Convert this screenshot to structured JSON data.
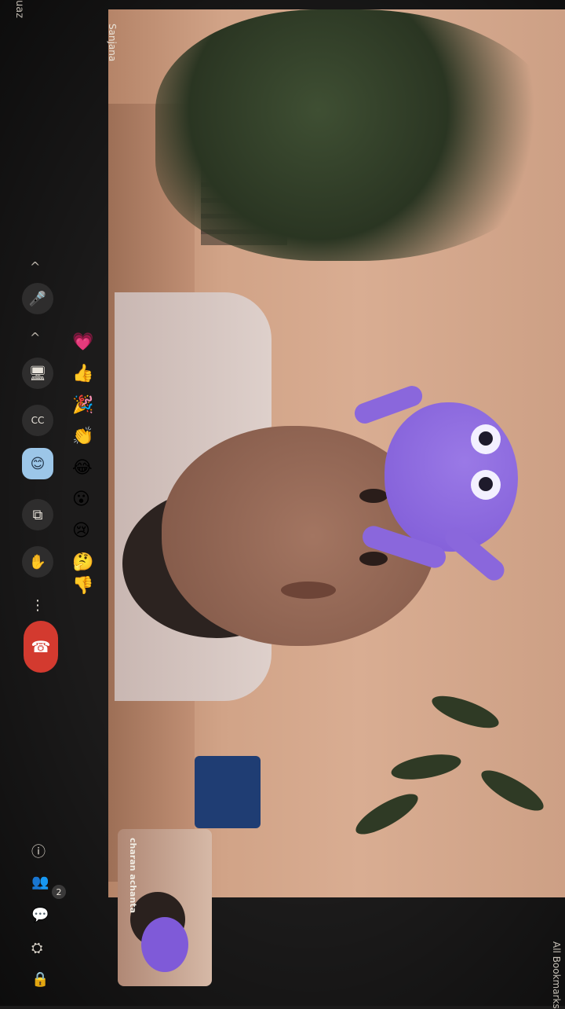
{
  "header": {
    "top_fragment": "uaz"
  },
  "video": {
    "main_name": "Sanjana",
    "thumbnail_name": "charan achanta"
  },
  "reactions": [
    "💗",
    "👍",
    "🎉",
    "👏",
    "😂",
    "😮",
    "😢",
    "🤔",
    "👎"
  ],
  "toolbar": {
    "chev1": "^",
    "mic": "🎤",
    "chev2": "^",
    "camera": "🖥",
    "captions": "CC",
    "emoji": "😊",
    "present": "⧉",
    "hand": "✋",
    "more": "⋮",
    "end": "☎"
  },
  "bottom_icons": {
    "info": "ⓘ",
    "people": "👥",
    "people_count": "2",
    "chat": "💬",
    "activities": "⛭",
    "lock": "🔒"
  },
  "rightfrag": "All Bookmarks"
}
